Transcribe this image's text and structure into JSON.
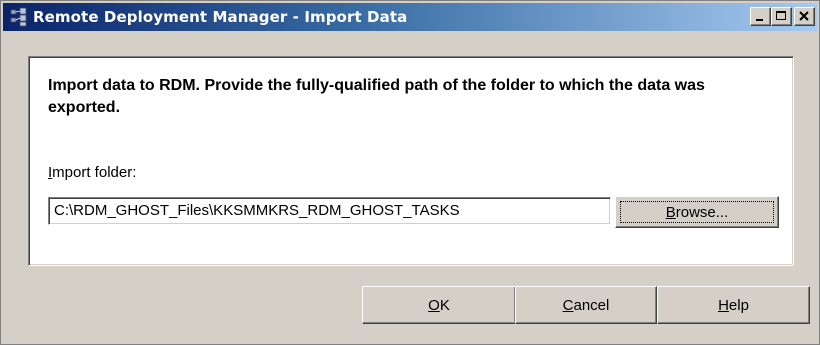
{
  "window": {
    "title": "Remote Deployment Manager - Import Data",
    "icon": "rdm-app-icon",
    "controls": [
      "minimize-icon",
      "maximize-icon",
      "close-icon"
    ]
  },
  "instruction": "Import data to RDM.  Provide the fully-qualified path of the folder to which the data was exported.",
  "import_folder": {
    "label_mnemonic": "I",
    "label_rest": "mport folder:",
    "value": "C:\\RDM_GHOST_Files\\KKSMMKRS_RDM_GHOST_TASKS",
    "browse_mnemonic": "B",
    "browse_rest": "rowse..."
  },
  "buttons": {
    "ok_mnemonic": "O",
    "ok_rest": "K",
    "cancel_mnemonic": "C",
    "cancel_rest": "ancel",
    "help_mnemonic": "H",
    "help_rest": "elp"
  },
  "colors": {
    "titlebar_start": "#0a246a",
    "titlebar_end": "#a6caf0",
    "face": "#d4d0c8"
  }
}
